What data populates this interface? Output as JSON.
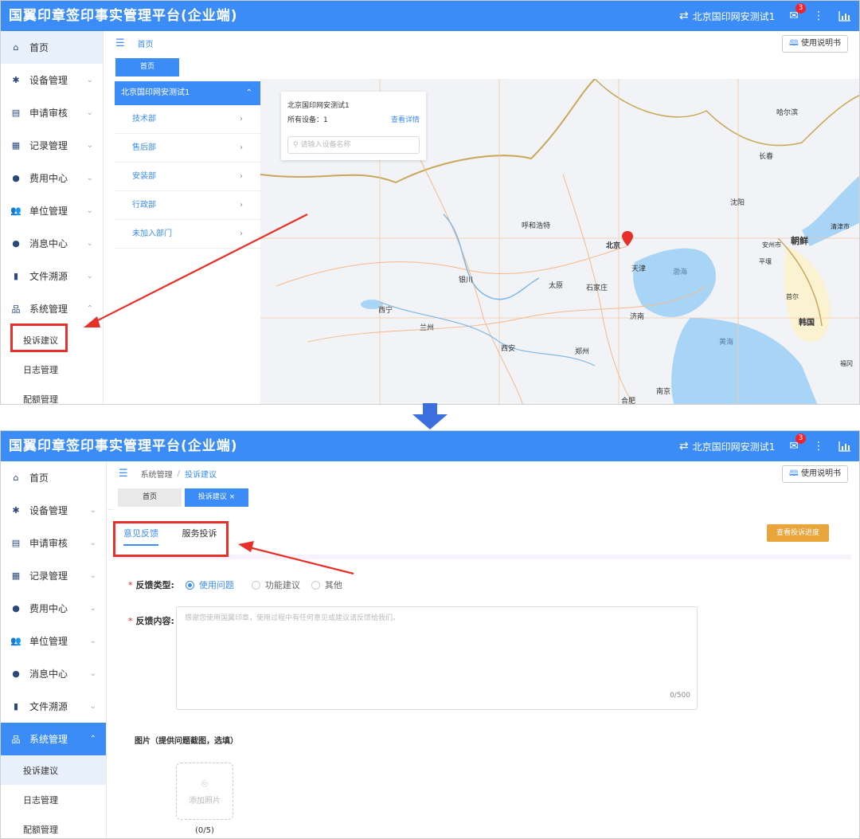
{
  "app": {
    "title": "国翼印章签印事实管理平台(企业端)",
    "account": "北京国印网安测试1",
    "mail_badge": "3",
    "manual_label": "使用说明书"
  },
  "sidebar": {
    "items": [
      {
        "label": "首页"
      },
      {
        "label": "设备管理"
      },
      {
        "label": "申请审核"
      },
      {
        "label": "记录管理"
      },
      {
        "label": "费用中心"
      },
      {
        "label": "单位管理"
      },
      {
        "label": "消息中心"
      },
      {
        "label": "文件溯源"
      },
      {
        "label": "系统管理"
      }
    ],
    "sub_items": [
      {
        "label": "投诉建议"
      },
      {
        "label": "日志管理"
      },
      {
        "label": "配额管理"
      }
    ]
  },
  "shot1": {
    "breadcrumb": "首页",
    "tab_home": "首页",
    "dept_head": "北京国印网安测试1",
    "depts": [
      "技术部",
      "售后部",
      "安装部",
      "行政部",
      "未加入部门"
    ],
    "card": {
      "title": "北京国印网安测试1",
      "devices_label": "所有设备：",
      "devices_count": "1",
      "detail_link": "查看详情",
      "search_placeholder": "请输入设备名称"
    },
    "map_labels": [
      "哈尔滨",
      "长春",
      "沈阳",
      "呼和浩特",
      "北京",
      "天津",
      "银川",
      "太原",
      "石家庄",
      "西宁",
      "兰州",
      "济南",
      "西安",
      "郑州",
      "合肥",
      "南京",
      "朝鲜",
      "韩国",
      "安州市",
      "平壤",
      "首尔",
      "渤海",
      "黄海",
      "福冈",
      "清津市"
    ]
  },
  "shot2": {
    "breadcrumb_root": "系统管理",
    "breadcrumb_sep": "/",
    "breadcrumb_leaf": "投诉建议",
    "tab_home": "首页",
    "tab_active": "投诉建议",
    "tab_close": "×",
    "content_tabs": [
      "意见反馈",
      "服务投诉"
    ],
    "progress_button": "查看投诉进度",
    "form": {
      "type_label": "反馈类型:",
      "type_options": [
        "使用问题",
        "功能建议",
        "其他"
      ],
      "content_label": "反馈内容:",
      "content_placeholder": "感谢您使用国翼印章，使用过程中有任何意见或建议请反馈给我们。",
      "char_count": "0/500",
      "image_label": "图片（提供问题截图，选填）",
      "upload_label": "添加照片",
      "upload_count": "(0/5)"
    }
  },
  "colors": {
    "primary": "#3b8cf6",
    "annotation_red": "#e8302a",
    "warning": "#e9a43a"
  }
}
